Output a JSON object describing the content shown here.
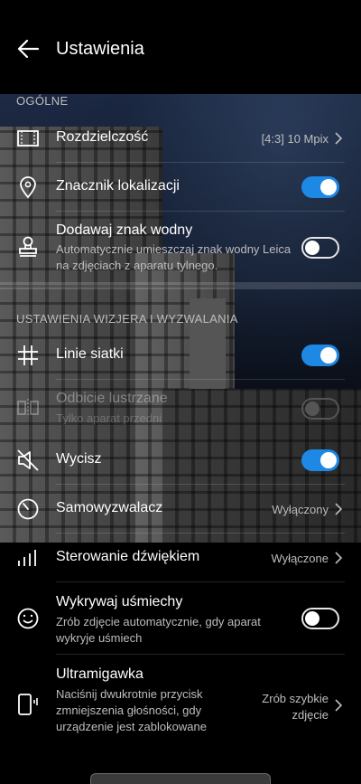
{
  "header": {
    "title": "Ustawienia"
  },
  "sections": {
    "general": "OGÓLNE",
    "viewfinder": "USTAWIENIA WIZJERA I WYZWALANIA"
  },
  "rows": {
    "resolution": {
      "label": "Rozdzielczość",
      "value": "[4:3] 10 Mpix",
      "icon": "resolution-icon"
    },
    "location": {
      "label": "Znacznik lokalizacji",
      "toggle": "on",
      "icon": "location-pin-icon"
    },
    "watermark": {
      "label": "Dodawaj znak wodny",
      "sub": "Automatycznie umieszczaj znak wodny Leica na zdjęciach z aparatu tylnego.",
      "toggle": "off",
      "icon": "stamp-icon"
    },
    "grid": {
      "label": "Linie siatki",
      "toggle": "on",
      "icon": "grid-icon"
    },
    "mirror": {
      "label": "Odbicie lustrzane",
      "sub": "Tylko aparat przedni",
      "toggle": "disabled",
      "icon": "mirror-icon"
    },
    "mute": {
      "label": "Wycisz",
      "toggle": "on",
      "icon": "mute-icon"
    },
    "timer": {
      "label": "Samowyzwalacz",
      "value": "Wyłączony",
      "icon": "timer-icon"
    },
    "sound": {
      "label": "Sterowanie dźwiękiem",
      "value": "Wyłączone",
      "icon": "sound-bars-icon"
    },
    "smile": {
      "label": "Wykrywaj uśmiechy",
      "sub": "Zrób zdjęcie automatycznie, gdy aparat wykryje uśmiech",
      "toggle": "off",
      "icon": "smile-icon"
    },
    "ultrasnap": {
      "label": "Ultramigawka",
      "sub": "Naciśnij dwukrotnie przycisk zmniejszenia głośności, gdy urządzenie jest zablokowane",
      "value": "Zrób szybkie zdjęcie",
      "icon": "phone-icon"
    }
  },
  "colors": {
    "accent": "#1e88e5",
    "background": "#000000",
    "secondary_text": "#bdbdbd"
  }
}
